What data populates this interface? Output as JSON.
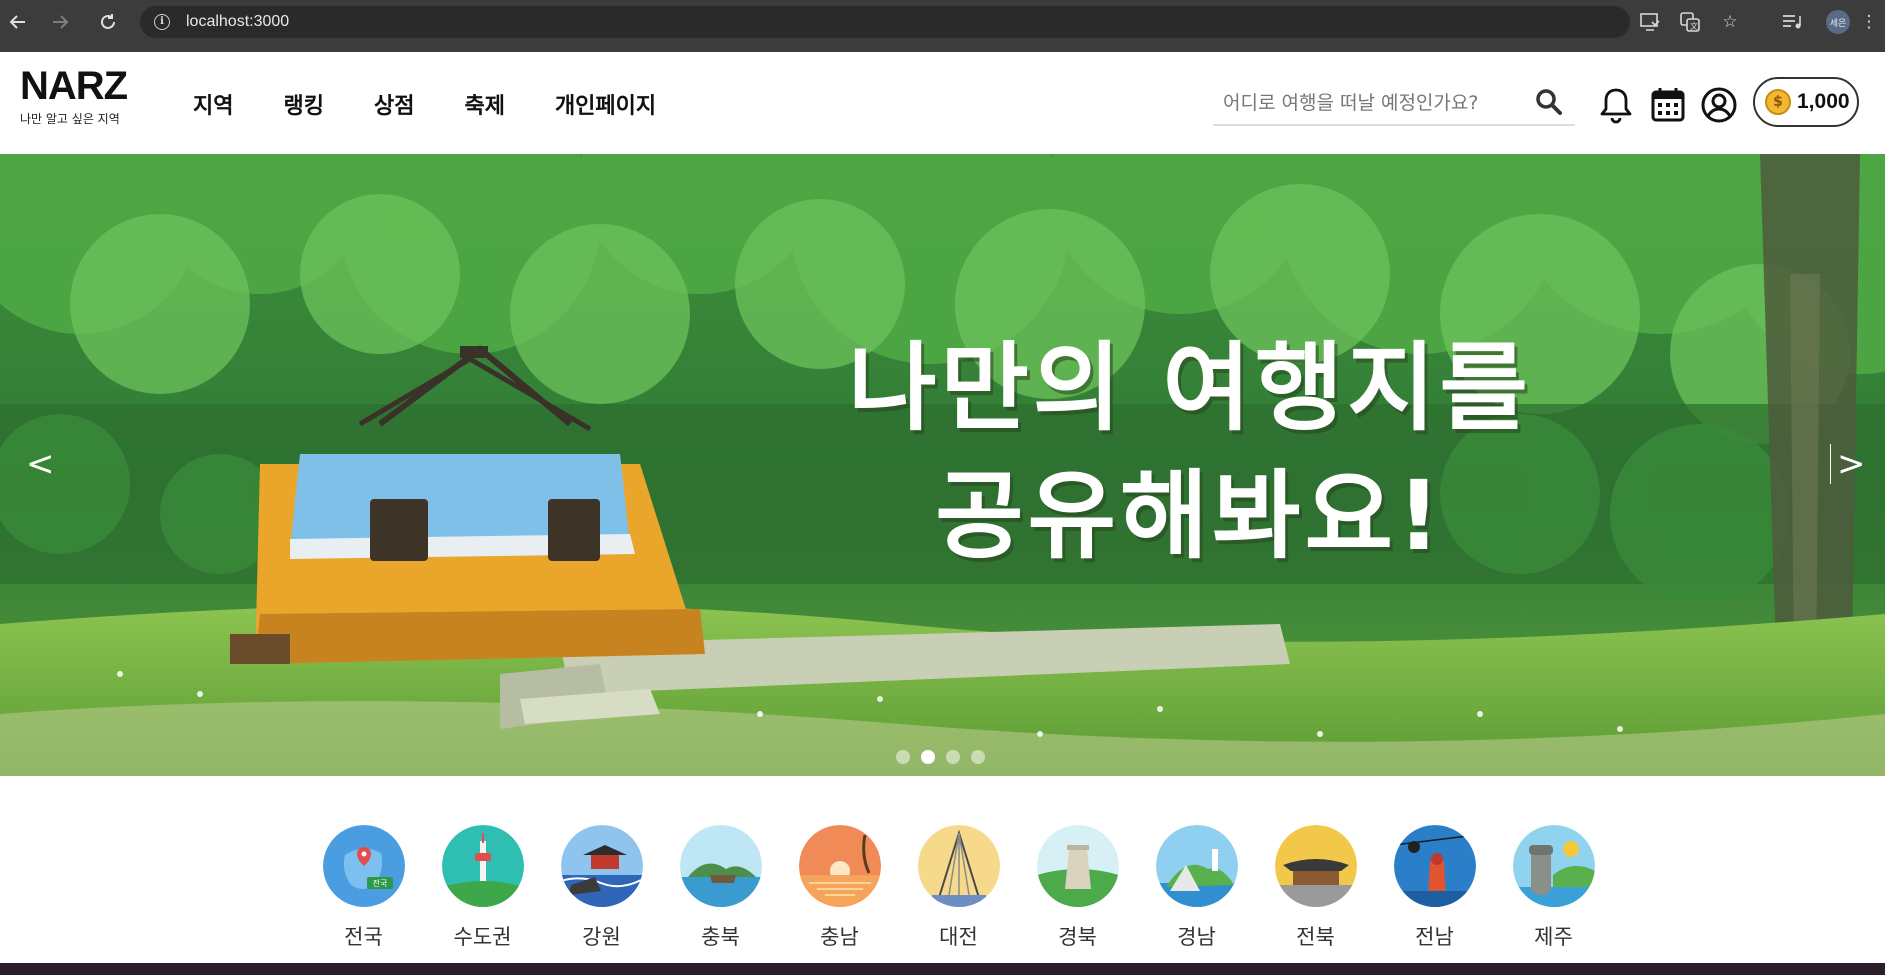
{
  "browser": {
    "url": "localhost:3000",
    "profile_initials": "세은",
    "icons": [
      "back-arrow-icon",
      "forward-arrow-icon",
      "reload-icon",
      "info-icon",
      "install-app-icon",
      "translate-icon",
      "bookmark-star-icon",
      "media-control-icon"
    ]
  },
  "header": {
    "logo_title": "NARZ",
    "logo_subtitle": "나만 알고 싶은 지역",
    "nav": [
      "지역",
      "랭킹",
      "상점",
      "축제",
      "개인페이지"
    ],
    "search_placeholder": "어디로 여행을 떠날 예정인가요?",
    "coins": "1,000",
    "coin_symbol": "$",
    "icons": [
      "search-icon",
      "bell-icon",
      "calendar-icon",
      "user-icon",
      "coin-icon"
    ]
  },
  "hero": {
    "title_line1": "나만의 여행지를",
    "title_line2": "공유해봐요!",
    "prev_label": "<",
    "next_label": ">",
    "slide_count": 4,
    "active_slide": 2
  },
  "regions": [
    {
      "label": "전국",
      "badge": "전국",
      "color": "#4a9de0"
    },
    {
      "label": "수도권",
      "color": "#2fbfb2"
    },
    {
      "label": "강원",
      "color": "#4a7fd0"
    },
    {
      "label": "충북",
      "color": "#8fd0e8"
    },
    {
      "label": "충남",
      "color": "#f08a56"
    },
    {
      "label": "대전",
      "color": "#f6d98a"
    },
    {
      "label": "경북",
      "color": "#5bb85a"
    },
    {
      "label": "경남",
      "color": "#3aa5e0"
    },
    {
      "label": "전북",
      "color": "#f2c84a"
    },
    {
      "label": "전남",
      "color": "#2a7fc8"
    },
    {
      "label": "제주",
      "color": "#8fd3ef"
    }
  ],
  "colors": {
    "chrome_bg": "#3c3c3c",
    "url_bar_bg": "#2a2a2a",
    "coin_gold": "#f3b734",
    "hero_green": "#5aa84a"
  }
}
